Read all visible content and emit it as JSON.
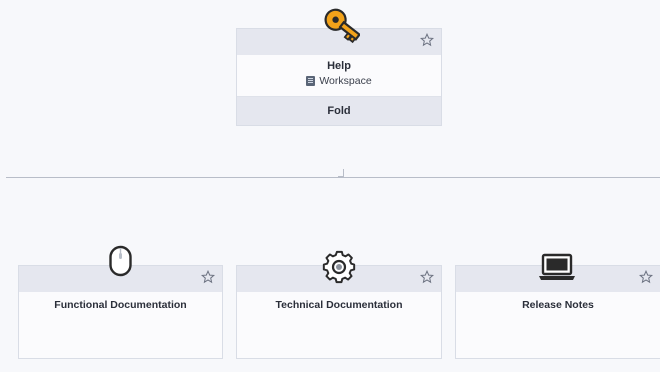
{
  "root": {
    "icon": "key-icon",
    "title": "Help",
    "workspace_label": "Workspace",
    "fold_label": "Fold",
    "star_icon": "star-icon"
  },
  "children": [
    {
      "icon": "mouse-icon",
      "title": "Functional Documentation"
    },
    {
      "icon": "gear-icon",
      "title": "Technical Documentation"
    },
    {
      "icon": "laptop-icon",
      "title": "Release Notes"
    }
  ],
  "colors": {
    "key": "#f2a21a",
    "card_header": "#e5e7ef",
    "background": "#f7f8fb",
    "divider": "#b8bdc8"
  }
}
